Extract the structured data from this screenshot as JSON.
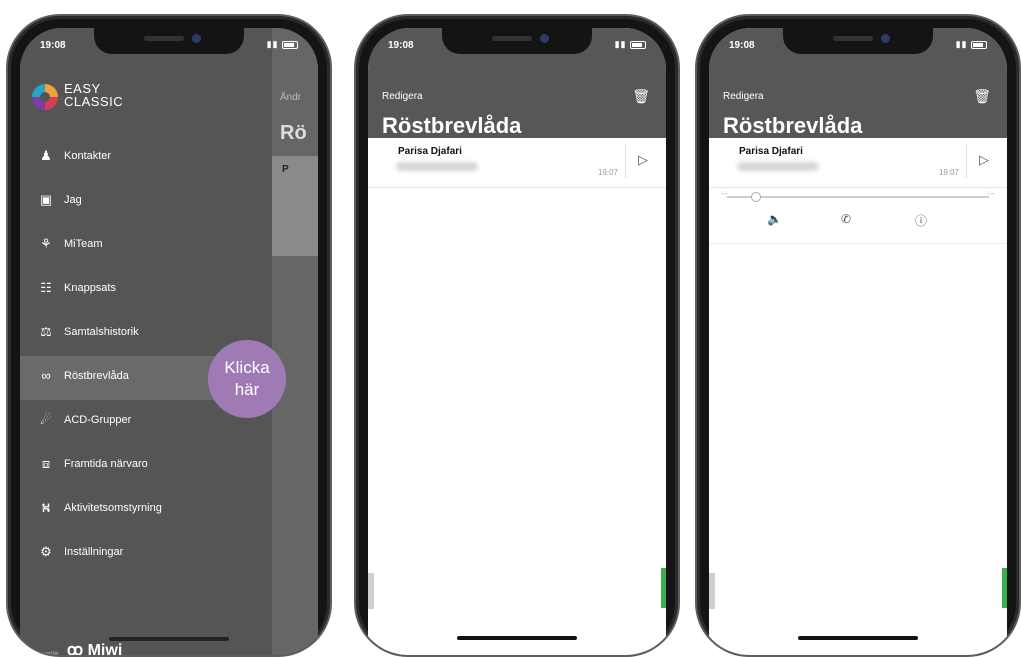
{
  "status": {
    "time": "19:08",
    "icons": "..l ≈"
  },
  "phone1": {
    "logo": {
      "line1": "EASY",
      "line2": "CLASSIC"
    },
    "menu_items": [
      {
        "label": "Kontakter",
        "icon": "contacts-icon",
        "glyph": "♟"
      },
      {
        "label": "Jag",
        "icon": "profile-card-icon",
        "glyph": "▣"
      },
      {
        "label": "MiTeam",
        "icon": "team-icon",
        "glyph": "⚘"
      },
      {
        "label": "Knappsats",
        "icon": "keypad-icon",
        "glyph": "☷"
      },
      {
        "label": "Samtalshistorik",
        "icon": "call-history-icon",
        "glyph": "⚖"
      },
      {
        "label": "Röstbrevlåda",
        "icon": "voicemail-icon",
        "glyph": "∞"
      },
      {
        "label": "ACD-Grupper",
        "icon": "acd-groups-icon",
        "glyph": "☄"
      },
      {
        "label": "Framtida närvaro",
        "icon": "future-presence-icon",
        "glyph": "⧈"
      },
      {
        "label": "Aktivitetsomstyrning",
        "icon": "activity-routing-icon",
        "glyph": "⛕"
      },
      {
        "label": "Inställningar",
        "icon": "settings-icon",
        "glyph": "⚙"
      }
    ],
    "active_index": 5,
    "callout": {
      "line1": "Klicka",
      "line2": "här"
    },
    "under": {
      "edit": "Ändr",
      "title": "Rö",
      "card_initial": "P"
    },
    "powered_by": "Powered by",
    "brand": "ꝏ Miwi"
  },
  "voicemail": {
    "edit_label": "Redigera",
    "title": "Röstbrevlåda",
    "entry": {
      "name": "Parisa Djafari",
      "time": "19:07"
    }
  }
}
